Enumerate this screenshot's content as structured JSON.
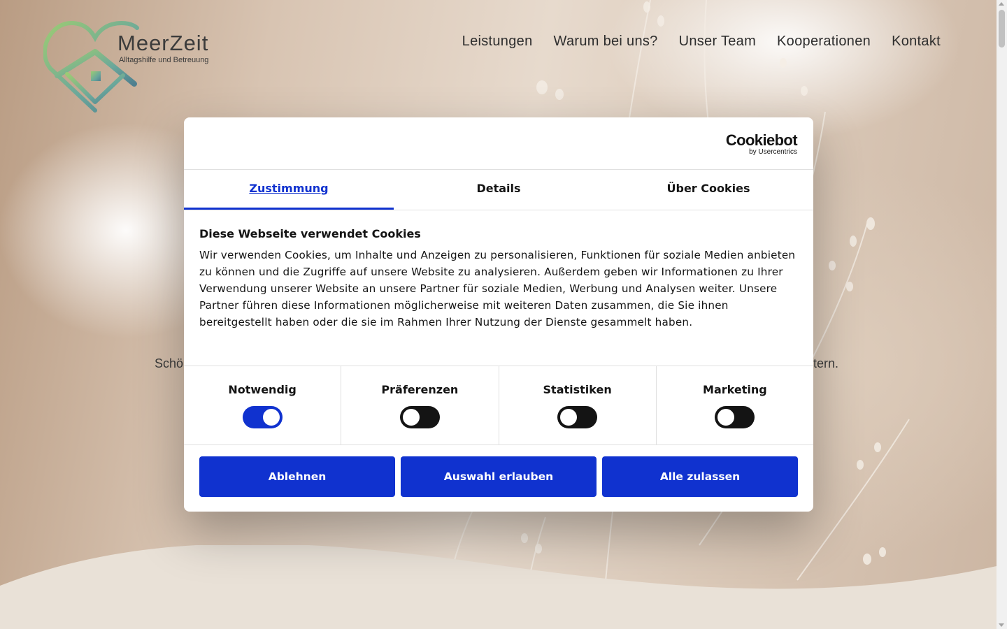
{
  "brand": {
    "name": "MeerZeit",
    "tagline": "Alltagshilfe und Betreuung"
  },
  "nav": [
    "Leistungen",
    "Warum bei uns?",
    "Unser Team",
    "Kooperationen",
    "Kontakt"
  ],
  "hero": {
    "text_left_visible": "Schö",
    "text_right_visible": "tern."
  },
  "cookie_dialog": {
    "provider": {
      "name": "Cookiebot",
      "sub": "by Usercentrics"
    },
    "tabs": [
      "Zustimmung",
      "Details",
      "Über Cookies"
    ],
    "active_tab": "Zustimmung",
    "heading": "Diese Webseite verwendet Cookies",
    "body": "Wir verwenden Cookies, um Inhalte und Anzeigen zu personalisieren, Funktionen für soziale Medien anbieten zu können und die Zugriffe auf unsere Website zu analysieren. Außerdem geben wir Informationen zu Ihrer Verwendung unserer Website an unsere Partner für soziale Medien, Werbung und Analysen weiter. Unsere Partner führen diese Informationen möglicherweise mit weiteren Daten zusammen, die Sie ihnen bereitgestellt haben oder die sie im Rahmen Ihrer Nutzung der Dienste gesammelt haben.",
    "categories": [
      {
        "label": "Notwendig",
        "enabled": true
      },
      {
        "label": "Präferenzen",
        "enabled": false
      },
      {
        "label": "Statistiken",
        "enabled": false
      },
      {
        "label": "Marketing",
        "enabled": false
      }
    ],
    "buttons": {
      "deny": "Ablehnen",
      "allow_selection": "Auswahl erlauben",
      "allow_all": "Alle zulassen"
    }
  },
  "colors": {
    "accent": "#1032cf",
    "toggle_off": "#141414",
    "text": "#141414"
  }
}
